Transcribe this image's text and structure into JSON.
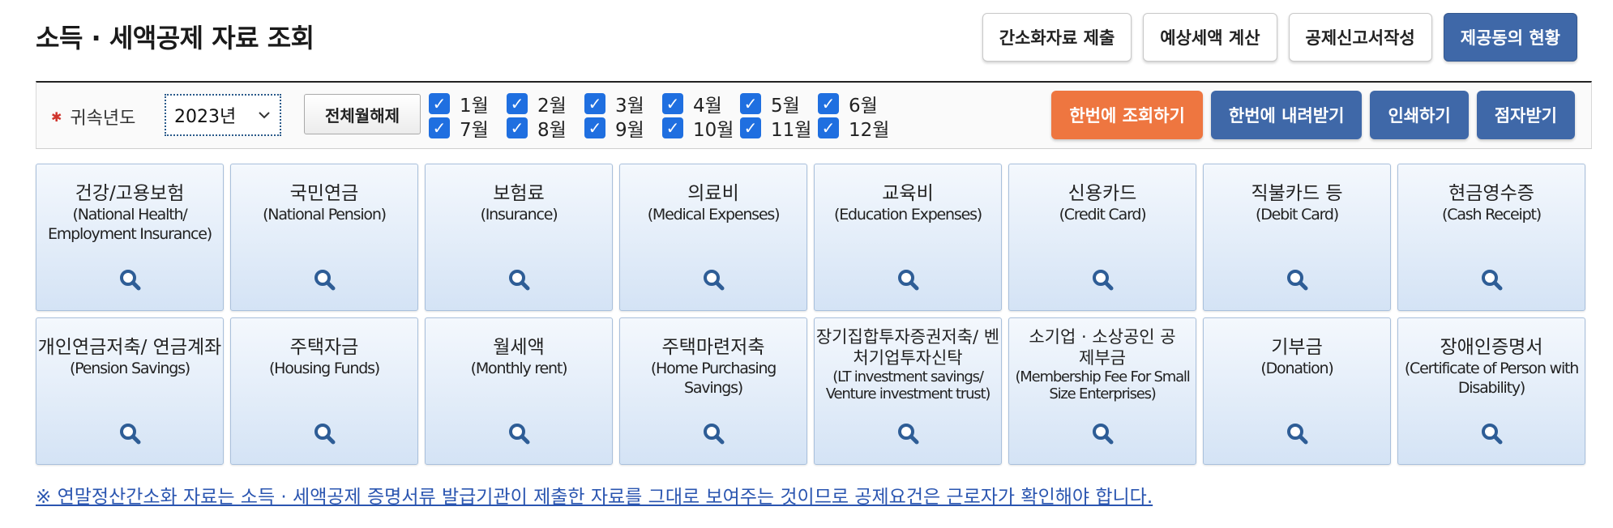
{
  "page": {
    "title": "소득 · 세액공제 자료 조회"
  },
  "top_buttons": [
    {
      "label": "간소화자료 제출"
    },
    {
      "label": "예상세액 계산"
    },
    {
      "label": "공제신고서작성"
    },
    {
      "label": "제공동의 현황"
    }
  ],
  "filter": {
    "year_label": "귀속년도",
    "year_value": "2023년",
    "deselect_all_label": "전체월해제",
    "months": [
      "1월",
      "2월",
      "3월",
      "4월",
      "5월",
      "6월",
      "7월",
      "8월",
      "9월",
      "10월",
      "11월",
      "12월"
    ],
    "months_checked": [
      true,
      true,
      true,
      true,
      true,
      true,
      true,
      true,
      true,
      true,
      true,
      true
    ],
    "actions": [
      {
        "label": "한번에 조회하기",
        "color": "#ee7640"
      },
      {
        "label": "한번에 내려받기",
        "color": "#3f68a8"
      },
      {
        "label": "인쇄하기",
        "color": "#3f68a8"
      },
      {
        "label": "점자받기",
        "color": "#3f68a8"
      }
    ]
  },
  "cards": [
    {
      "kr": "건강/고용보험",
      "en": "(National Health/ Employment Insurance)"
    },
    {
      "kr": "국민연금",
      "en": "(National Pension)"
    },
    {
      "kr": "보험료",
      "en": "(Insurance)"
    },
    {
      "kr": "의료비",
      "en": "(Medical Expenses)"
    },
    {
      "kr": "교육비",
      "en": "(Education Expenses)"
    },
    {
      "kr": "신용카드",
      "en": "(Credit Card)"
    },
    {
      "kr": "직불카드 등",
      "en": "(Debit Card)"
    },
    {
      "kr": "현금영수증",
      "en": "(Cash Receipt)"
    },
    {
      "kr": "개인연금저축/ 연금계좌",
      "en": "(Pension Savings)"
    },
    {
      "kr": "주택자금",
      "en": "(Housing Funds)"
    },
    {
      "kr": "월세액",
      "en": "(Monthly rent)"
    },
    {
      "kr": "주택마련저축",
      "en": "(Home Purchasing Savings)"
    },
    {
      "kr": "장기집합투자증권저축/ 벤처기업투자신탁",
      "en": "(LT investment savings/ Venture investment trust)"
    },
    {
      "kr": "소기업 · 소상공인 공제부금",
      "en": "(Membership Fee For Small Size Enterprises)"
    },
    {
      "kr": "기부금",
      "en": "(Donation)"
    },
    {
      "kr": "장애인증명서",
      "en": "(Certificate of Person with Disability)"
    }
  ],
  "notice": "※ 연말정산간소화 자료는 소득 · 세액공제 증명서류 발급기관이 제출한 자료를 그대로 보여주는 것이므로 공제요건은 근로자가 확인해야 합니다.",
  "colors": {
    "primary_blue": "#3f68a8",
    "orange": "#ee7640",
    "checkbox": "#1f6fe0",
    "link": "#2a55b0"
  }
}
